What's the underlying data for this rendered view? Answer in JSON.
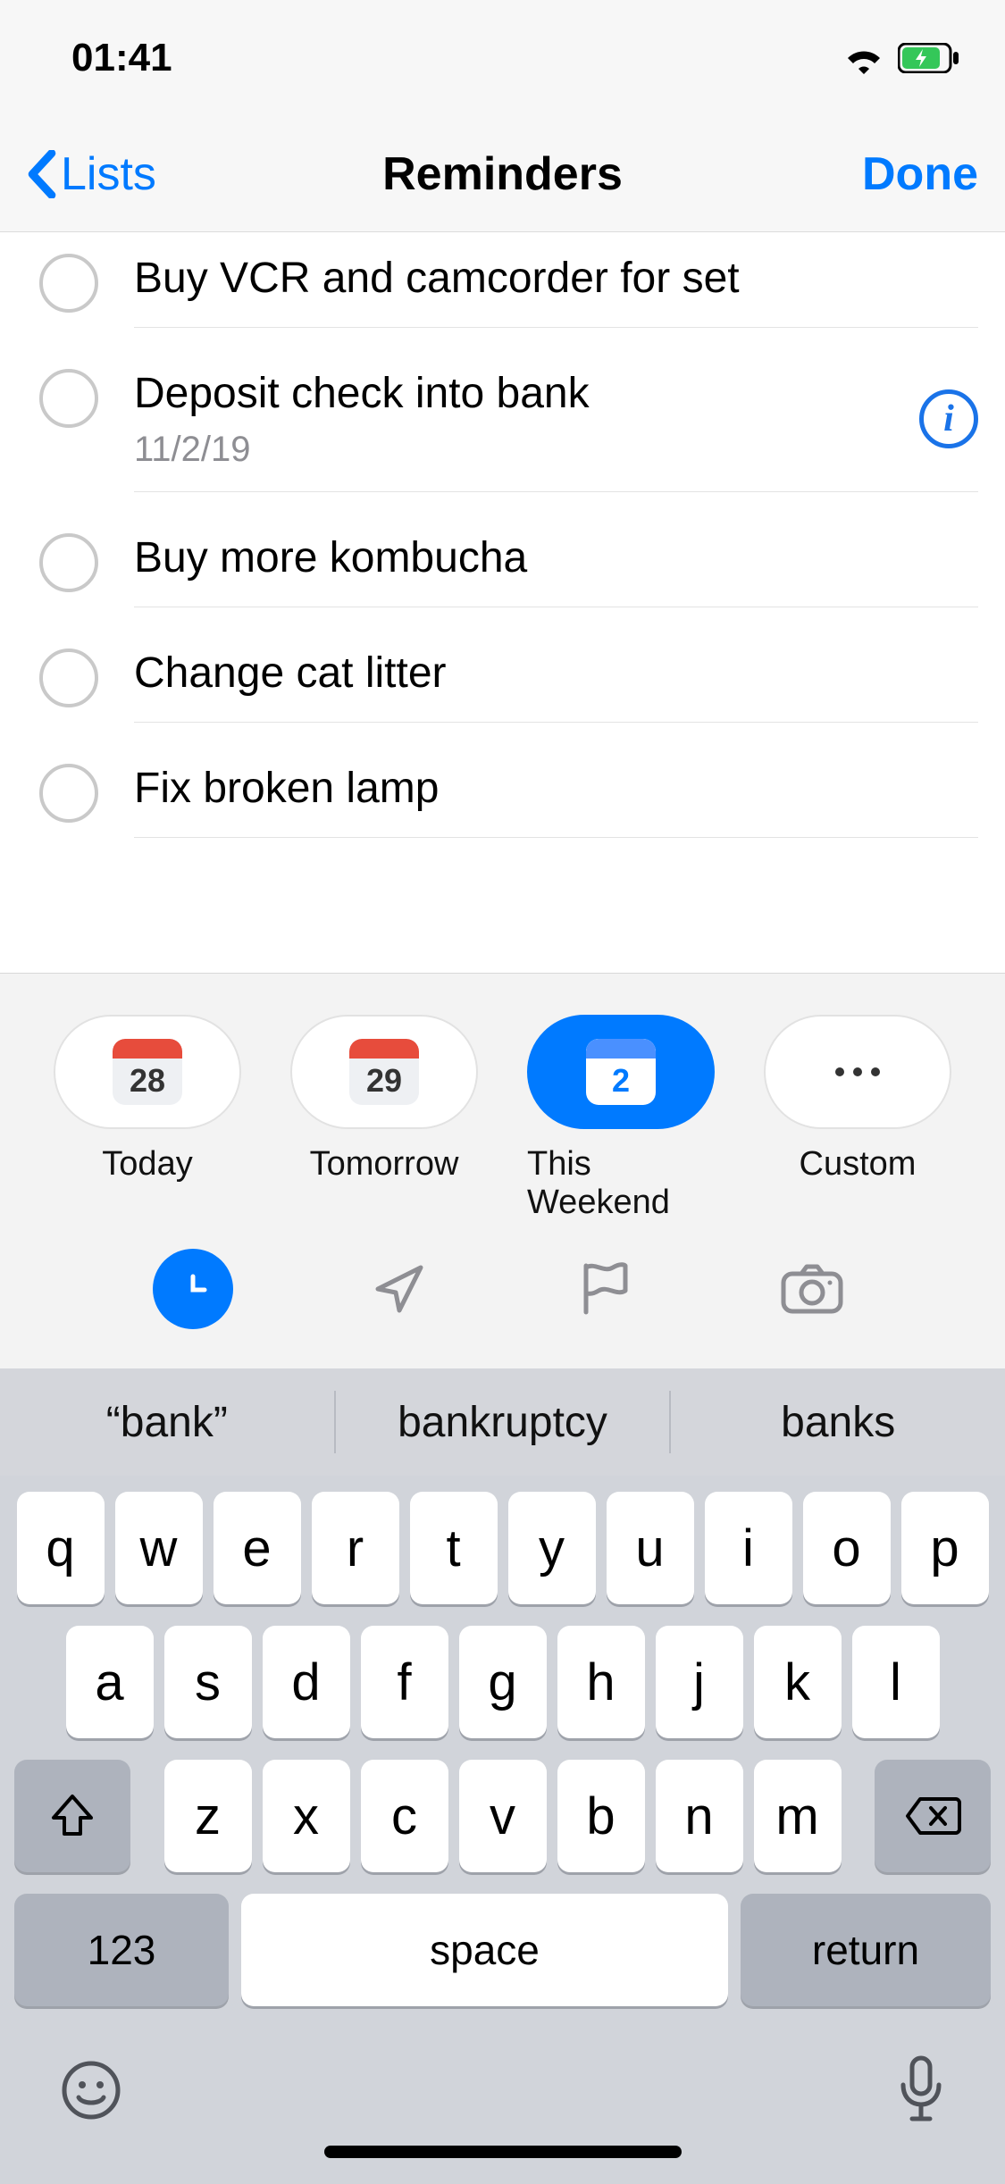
{
  "status": {
    "time": "01:41"
  },
  "nav": {
    "back": "Lists",
    "title": "Reminders",
    "done": "Done"
  },
  "reminders": [
    {
      "title": "Buy VCR and camcorder for set",
      "date": "",
      "showInfo": false
    },
    {
      "title": "Deposit check into bank",
      "date": "11/2/19",
      "showInfo": true
    },
    {
      "title": "Buy more kombucha",
      "date": "",
      "showInfo": false
    },
    {
      "title": "Change cat litter",
      "date": "",
      "showInfo": false
    },
    {
      "title": "Fix broken lamp",
      "date": "",
      "showInfo": false
    }
  ],
  "chips": {
    "today": {
      "label": "Today",
      "num": "28"
    },
    "tomorrow": {
      "label": "Tomorrow",
      "num": "29"
    },
    "weekend": {
      "label": "This Weekend",
      "num": "2",
      "selected": true
    },
    "custom": {
      "label": "Custom"
    }
  },
  "keyboard": {
    "suggestions": [
      "“bank”",
      "bankruptcy",
      "banks"
    ],
    "row1": [
      "q",
      "w",
      "e",
      "r",
      "t",
      "y",
      "u",
      "i",
      "o",
      "p"
    ],
    "row2": [
      "a",
      "s",
      "d",
      "f",
      "g",
      "h",
      "j",
      "k",
      "l"
    ],
    "row3": [
      "z",
      "x",
      "c",
      "v",
      "b",
      "n",
      "m"
    ],
    "k123": "123",
    "space": "space",
    "ret": "return"
  }
}
